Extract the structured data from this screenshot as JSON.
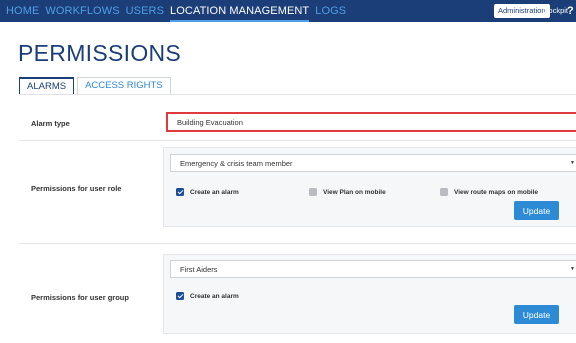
{
  "nav": {
    "items": [
      "HOME",
      "WORKFLOWS",
      "USERS",
      "LOCATION MANAGEMENT",
      "LOGS"
    ],
    "active_index": 3
  },
  "header_right": {
    "admin_label": "Administration",
    "cockpit_label": "Cockpit",
    "help_label": "?"
  },
  "page": {
    "title": "PERMISSIONS"
  },
  "tabs": [
    {
      "label": "ALARMS",
      "active": true
    },
    {
      "label": "ACCESS RIGHTS",
      "active": false
    }
  ],
  "alarm_type": {
    "label": "Alarm type",
    "selected": "Building Evacuation"
  },
  "user_role": {
    "label": "Permissions for user role",
    "selected": "Emergency & crisis team member",
    "checkboxes": [
      {
        "label": "Create an alarm",
        "checked": true
      },
      {
        "label": "View Plan on mobile",
        "checked": false
      },
      {
        "label": "View route maps on mobile",
        "checked": false
      }
    ],
    "button_label": "Update"
  },
  "user_group": {
    "label": "Permissions for user group",
    "selected": "First Aiders",
    "checkboxes": [
      {
        "label": "Create an alarm",
        "checked": true
      }
    ],
    "button_label": "Update"
  },
  "colors": {
    "topbar": "#1b3e78",
    "nav_link": "#4f9ee6",
    "accent": "#2d8bd6",
    "highlight": "#e0393e"
  }
}
